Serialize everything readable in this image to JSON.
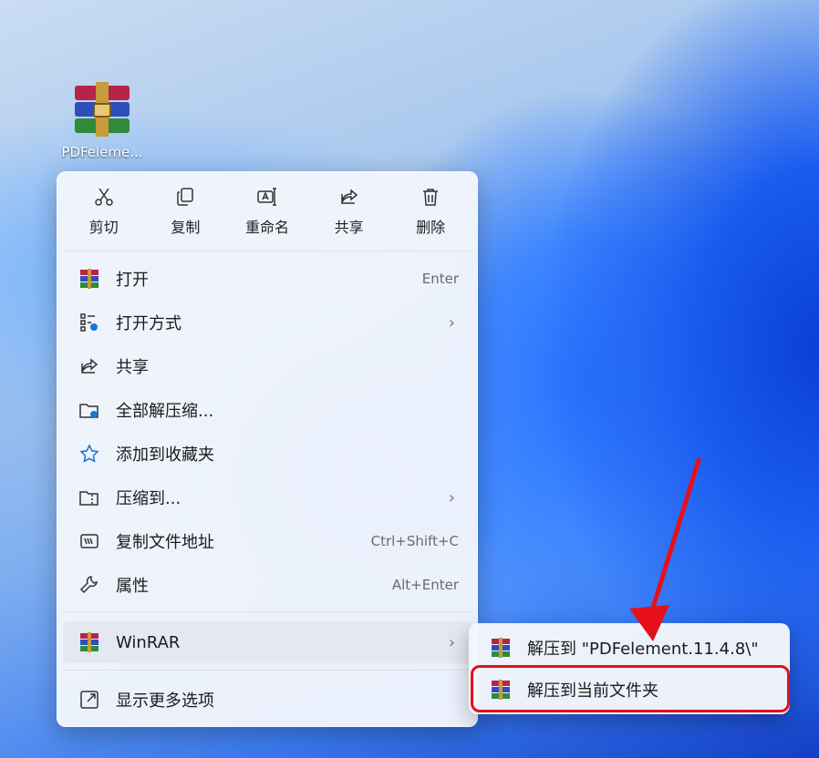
{
  "desktop": {
    "icon_label": "PDFeleme..."
  },
  "quickbar": [
    {
      "label": "剪切",
      "icon": "scissors-icon"
    },
    {
      "label": "复制",
      "icon": "copy-icon"
    },
    {
      "label": "重命名",
      "icon": "rename-icon"
    },
    {
      "label": "共享",
      "icon": "share-icon"
    },
    {
      "label": "删除",
      "icon": "trash-icon"
    }
  ],
  "menu": [
    {
      "label": "打开",
      "shortcut": "Enter",
      "icon": "winrar-icon"
    },
    {
      "label": "打开方式",
      "shortcut": "",
      "icon": "open-with-icon",
      "submenu": true
    },
    {
      "label": "共享",
      "shortcut": "",
      "icon": "share-icon"
    },
    {
      "label": "全部解压缩...",
      "shortcut": "",
      "icon": "extract-folder-icon"
    },
    {
      "label": "添加到收藏夹",
      "shortcut": "",
      "icon": "star-icon"
    },
    {
      "label": "压缩到...",
      "shortcut": "",
      "icon": "compress-icon",
      "submenu": true
    },
    {
      "label": "复制文件地址",
      "shortcut": "Ctrl+Shift+C",
      "icon": "copy-path-icon"
    },
    {
      "label": "属性",
      "shortcut": "Alt+Enter",
      "icon": "wrench-icon"
    },
    {
      "label": "WinRAR",
      "shortcut": "",
      "icon": "winrar-icon",
      "submenu": true
    },
    {
      "label": "显示更多选项",
      "shortcut": "",
      "icon": "more-options-icon"
    }
  ],
  "submenu": [
    {
      "label": "解压到 \"PDFelement.11.4.8\\\"",
      "icon": "winrar-icon"
    },
    {
      "label": "解压到当前文件夹",
      "icon": "winrar-icon"
    }
  ],
  "colors": {
    "highlight_box": "#e6101b",
    "arrow": "#e6101b"
  }
}
